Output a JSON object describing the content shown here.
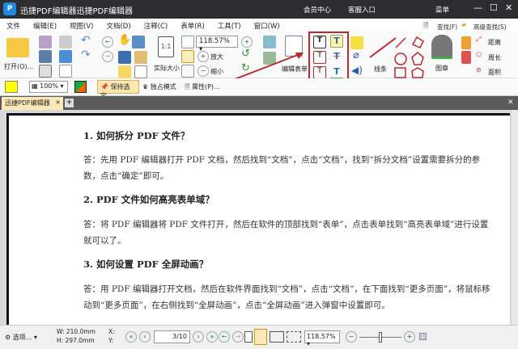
{
  "title": "迅捷PDF编辑器迅捷PDF编辑器",
  "title_links": {
    "member": "会员中心",
    "service": "客服入口",
    "menu": "菜单"
  },
  "menu": [
    "文件",
    "编辑(E)",
    "视图(V)",
    "文档(D)",
    "注释(C)",
    "表单(R)",
    "工具(T)",
    "窗口(W)"
  ],
  "toolbar": {
    "open": "打开(O)...",
    "actual_size": "实际大小",
    "zoom_value": "118.57%",
    "zoom_in": "放大",
    "zoom_out": "缩小",
    "edit_form": "编辑表单",
    "line": "线条",
    "stamp": "图章",
    "distance": "距离",
    "perimeter": "周长",
    "area": "面积",
    "find": "查找(F)",
    "advanced_find": "高级查找(S)"
  },
  "toolbar2": {
    "opacity": "100%",
    "keep_selected": "保持选定",
    "exclusive": "独占模式",
    "properties": "属性(P)..."
  },
  "tab": {
    "label": "迅捷PDF编辑器"
  },
  "colors": {
    "highlight": "#ffff00",
    "red_box": "#c0272d"
  },
  "document": {
    "h1": "1.  如何拆分 PDF 文件？",
    "p1": "答：先用 PDF 编辑器打开 PDF 文档，然后找到“文档”，点击“文档”，找到“拆分文档”设置需要拆分的参数，点击“确定”即可。",
    "h2": "2.  PDF 文件如何高亮表单域？",
    "p2": "答：将 PDF 编辑器将 PDF 文件打开，然后在软件的顶部找到“表单”，点击表单找到“高亮表单域”进行设置就可以了。",
    "h3": "3.  如何设置 PDF 全屏动画？",
    "p3": "答：用 PDF 编辑器打开文档，然后在软件界面找到“文档”，点击“文档”，在下面找到“更多页面”，将鼠标移动到“更多页面”，在右侧找到“全屏动画”，点击“全屏动画”进入弹窗中设置即可。"
  },
  "status": {
    "options": "选项...",
    "w": "W: 210.0mm",
    "h": "H: 297.0mm",
    "x": "X:",
    "y": "Y:",
    "page": "3/10",
    "zoom": "118.57%"
  }
}
